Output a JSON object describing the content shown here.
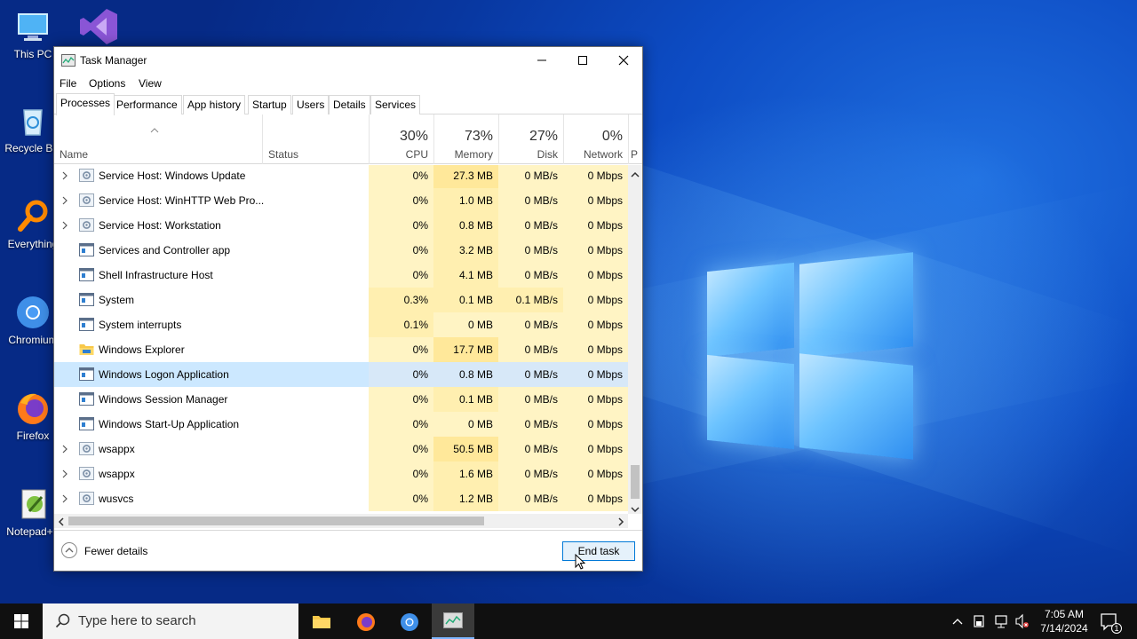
{
  "desktop": {
    "icons": [
      {
        "label": "This PC",
        "icon": "this-pc-icon"
      },
      {
        "label": "Recycle Bin",
        "icon": "recycle-bin-icon"
      },
      {
        "label": "Everything",
        "icon": "everything-search-icon"
      },
      {
        "label": "Chromium",
        "icon": "chromium-icon"
      },
      {
        "label": "Firefox",
        "icon": "firefox-icon"
      },
      {
        "label": "Notepad++",
        "icon": "notepad-plus-plus-icon"
      }
    ]
  },
  "window": {
    "title": "Task Manager",
    "menu": [
      "File",
      "Options",
      "View"
    ],
    "tabs": [
      "Processes",
      "Performance",
      "App history",
      "Startup",
      "Users",
      "Details",
      "Services"
    ],
    "active_tab": "Processes",
    "columns": {
      "name": "Name",
      "status": "Status",
      "cpu": {
        "pct": "30%",
        "label": "CPU"
      },
      "memory": {
        "pct": "73%",
        "label": "Memory"
      },
      "disk": {
        "pct": "27%",
        "label": "Disk"
      },
      "network": {
        "pct": "0%",
        "label": "Network"
      },
      "power_partial": "P"
    },
    "rows": [
      {
        "name": "Service Host: Windows Update",
        "expandable": true,
        "icon": "gear-icon",
        "cpu": "0%",
        "memory": "27.3 MB",
        "disk": "0 MB/s",
        "network": "0 Mbps"
      },
      {
        "name": "Service Host: WinHTTP Web Pro...",
        "expandable": true,
        "icon": "gear-icon",
        "cpu": "0%",
        "memory": "1.0 MB",
        "disk": "0 MB/s",
        "network": "0 Mbps"
      },
      {
        "name": "Service Host: Workstation",
        "expandable": true,
        "icon": "gear-icon",
        "cpu": "0%",
        "memory": "0.8 MB",
        "disk": "0 MB/s",
        "network": "0 Mbps"
      },
      {
        "name": "Services and Controller app",
        "expandable": false,
        "icon": "window-icon",
        "cpu": "0%",
        "memory": "3.2 MB",
        "disk": "0 MB/s",
        "network": "0 Mbps"
      },
      {
        "name": "Shell Infrastructure Host",
        "expandable": false,
        "icon": "window-icon",
        "cpu": "0%",
        "memory": "4.1 MB",
        "disk": "0 MB/s",
        "network": "0 Mbps"
      },
      {
        "name": "System",
        "expandable": false,
        "icon": "window-icon",
        "cpu": "0.3%",
        "memory": "0.1 MB",
        "disk": "0.1 MB/s",
        "network": "0 Mbps"
      },
      {
        "name": "System interrupts",
        "expandable": false,
        "icon": "window-icon",
        "cpu": "0.1%",
        "memory": "0 MB",
        "disk": "0 MB/s",
        "network": "0 Mbps"
      },
      {
        "name": "Windows Explorer",
        "expandable": false,
        "icon": "folder-icon",
        "cpu": "0%",
        "memory": "17.7 MB",
        "disk": "0 MB/s",
        "network": "0 Mbps"
      },
      {
        "name": "Windows Logon Application",
        "expandable": false,
        "icon": "window-icon",
        "cpu": "0%",
        "memory": "0.8 MB",
        "disk": "0 MB/s",
        "network": "0 Mbps",
        "selected": true
      },
      {
        "name": "Windows Session Manager",
        "expandable": false,
        "icon": "window-icon",
        "cpu": "0%",
        "memory": "0.1 MB",
        "disk": "0 MB/s",
        "network": "0 Mbps"
      },
      {
        "name": "Windows Start-Up Application",
        "expandable": false,
        "icon": "window-icon",
        "cpu": "0%",
        "memory": "0 MB",
        "disk": "0 MB/s",
        "network": "0 Mbps"
      },
      {
        "name": "wsappx",
        "expandable": true,
        "icon": "gear-icon",
        "cpu": "0%",
        "memory": "50.5 MB",
        "disk": "0 MB/s",
        "network": "0 Mbps"
      },
      {
        "name": "wsappx",
        "expandable": true,
        "icon": "gear-icon",
        "cpu": "0%",
        "memory": "1.6 MB",
        "disk": "0 MB/s",
        "network": "0 Mbps"
      },
      {
        "name": "wusvcs",
        "expandable": true,
        "icon": "gear-icon",
        "cpu": "0%",
        "memory": "1.2 MB",
        "disk": "0 MB/s",
        "network": "0 Mbps"
      }
    ],
    "footer": {
      "fewer_details": "Fewer details",
      "end_task": "End task"
    }
  },
  "taskbar": {
    "search_placeholder": "Type here to search",
    "apps": [
      "file-explorer-icon",
      "firefox-icon",
      "chromium-icon",
      "task-manager-icon"
    ],
    "active_app": "task-manager-icon",
    "time": "7:05 AM",
    "date": "7/14/2024",
    "notification_count": "1"
  },
  "colors": {
    "selection": "#cce8ff",
    "heat_light": "#fff4c4",
    "heat_mid": "#ffefb0",
    "accent": "#0078d7",
    "taskbar": "#101010"
  }
}
